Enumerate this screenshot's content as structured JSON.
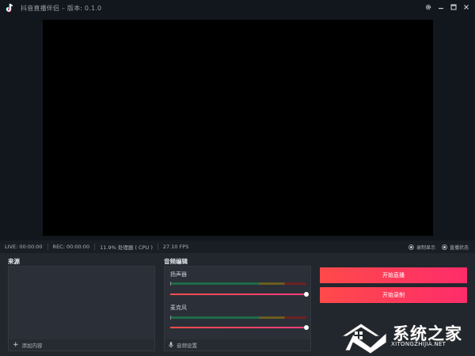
{
  "titlebar": {
    "title": "抖音直播伴侣 – 版本: 0.1.0",
    "logo_icon": "douyin-logo-icon",
    "controls": [
      "gear-icon",
      "minimize-icon",
      "maximize-icon",
      "close-icon"
    ]
  },
  "status": {
    "live": "LIVE: 00:00:00",
    "rec": "REC: 00:00:00",
    "cpu": "11.9% 处理器 ( CPU )",
    "fps": "27.10 FPS",
    "options": [
      {
        "label": "录制显示",
        "selected": true
      },
      {
        "label": "直播状态",
        "selected": true
      }
    ]
  },
  "sources": {
    "title": "来源",
    "add_label": "添加内容"
  },
  "audio": {
    "title": "音频编辑",
    "speaker_label": "扬声器",
    "speaker_volume": 1.0,
    "mic_label": "麦克风",
    "mic_volume": 1.0,
    "settings_label": "音频设置"
  },
  "actions": {
    "start_live": "开始直播",
    "start_record": "开始录制"
  },
  "colors": {
    "accent_start": "#fe4a4a",
    "accent_end": "#fe2c6a",
    "background": "#12171d",
    "panel": "#22272e"
  },
  "watermark": {
    "text": "系统之家",
    "url": "XITONGZHIJIA.NET"
  }
}
